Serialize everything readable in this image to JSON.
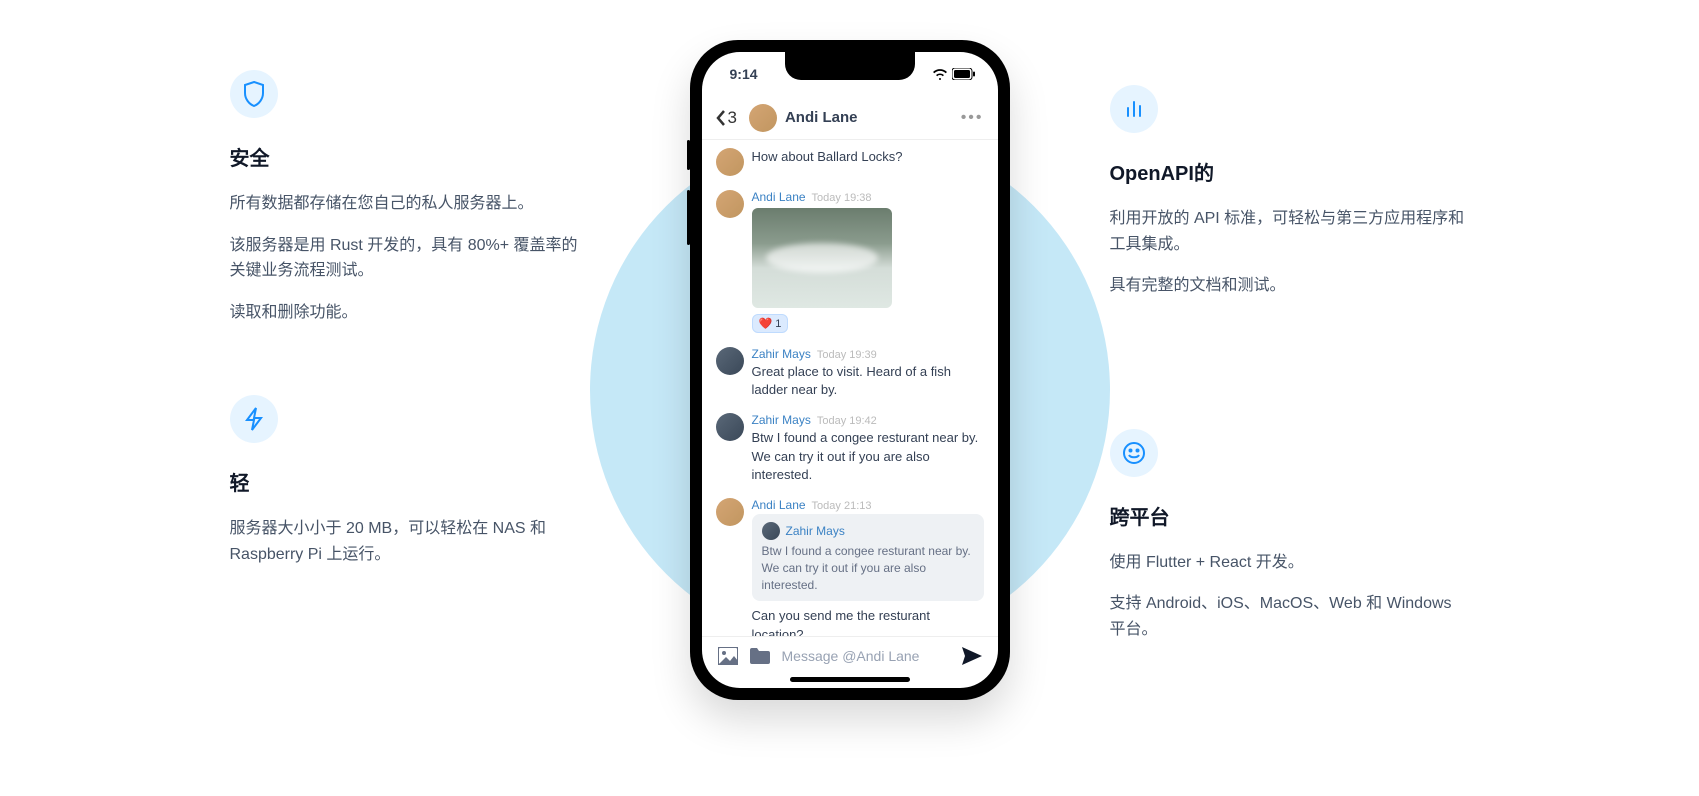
{
  "features": {
    "security": {
      "title": "安全",
      "p1": "所有数据都存储在您自己的私人服务器上。",
      "p2": "该服务器是用 Rust 开发的，具有 80%+ 覆盖率的关键业务流程测试。",
      "p3": "读取和删除功能。"
    },
    "light": {
      "title": "轻",
      "p1": "服务器大小小于 20 MB，可以轻松在 NAS 和 Raspberry Pi 上运行。"
    },
    "openapi": {
      "title": "OpenAPI的",
      "p1": "利用开放的 API 标准，可轻松与第三方应用程序和工具集成。",
      "p2": "具有完整的文档和测试。"
    },
    "cross": {
      "title": "跨平台",
      "p1": "使用 Flutter + React 开发。",
      "p2": "支持 Android、iOS、MacOS、Web 和 Windows 平台。"
    }
  },
  "phone": {
    "time": "9:14",
    "back_count": "3",
    "contact": "Andi Lane",
    "input_placeholder": "Message @Andi Lane",
    "messages": [
      {
        "type": "simple",
        "text": "How about Ballard Locks?"
      },
      {
        "type": "image",
        "name": "Andi Lane",
        "time": "Today 19:38",
        "reaction_emoji": "❤️",
        "reaction_count": "1"
      },
      {
        "type": "text",
        "name": "Zahir Mays",
        "time": "Today 19:39",
        "text": "Great place to visit. Heard of a fish ladder near by."
      },
      {
        "type": "text",
        "name": "Zahir Mays",
        "time": "Today 19:42",
        "text": "Btw I found a congee resturant near by. We can try it out if you are also interested."
      },
      {
        "type": "reply",
        "name": "Andi Lane",
        "time": "Today 21:13",
        "quote_name": "Zahir Mays",
        "quote_text": "Btw I found a congee resturant near by. We can try it out if you are also interested.",
        "text": "Can you send me the resturant location?"
      }
    ]
  }
}
